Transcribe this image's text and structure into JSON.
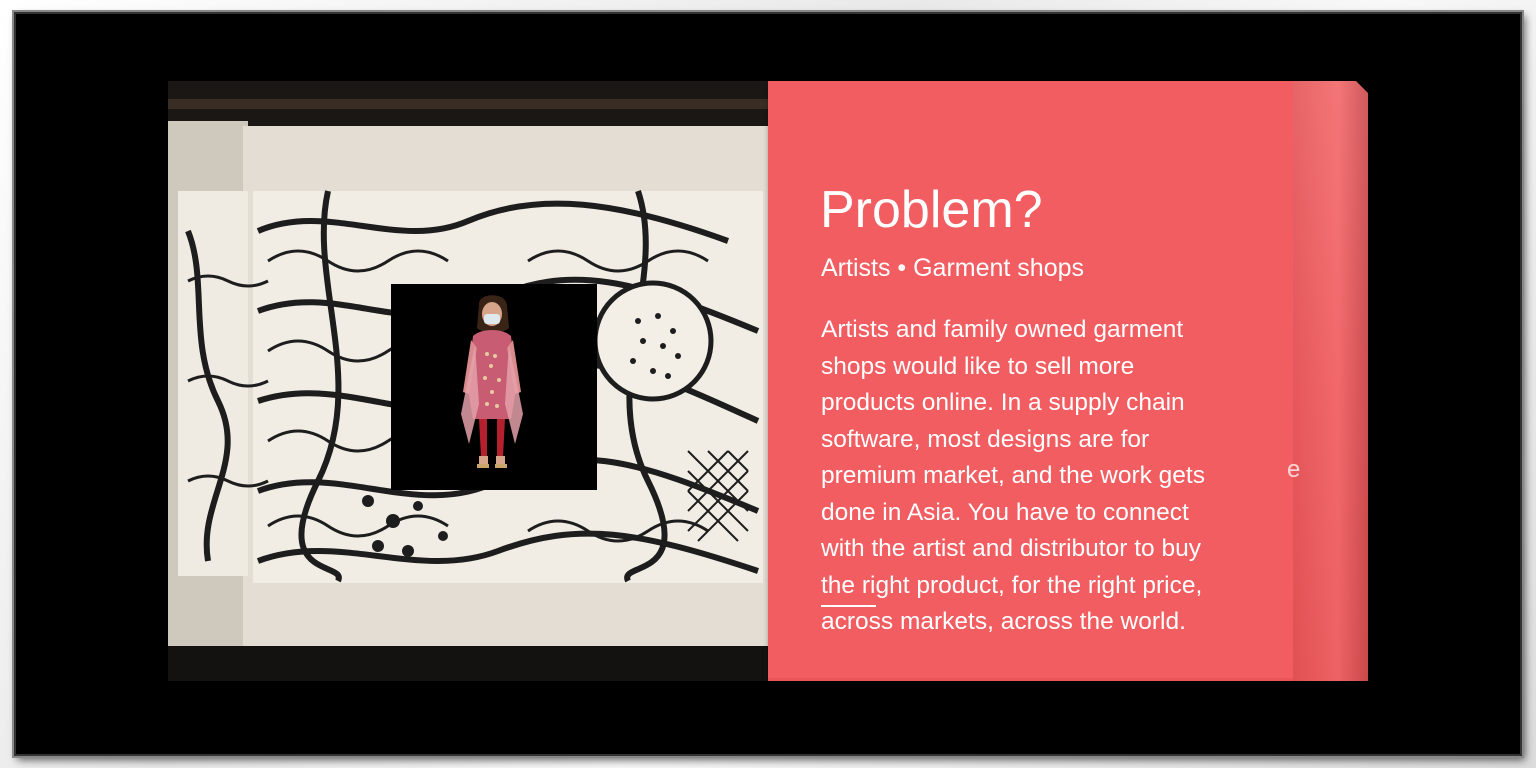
{
  "slide": {
    "title": "Problem?",
    "subtitle": "Artists • Garment shops",
    "body": "Artists and family owned garment\nshops  would like to sell more\nproducts online. In a supply chain\nsoftware, most designs are for\npremium market, and the work gets\ndone in Asia. You have to connect\nwith the artist and distributor to buy\nthe right product, for the right price,\nacross markets, across the world.",
    "ghost_char": "e"
  },
  "colors": {
    "panel": "#f15d60",
    "frame_background": "#000000",
    "text": "#ffffff"
  },
  "images": {
    "background_photo": "black-and-white-zentangle-drawing",
    "thumbnail": "woman-in-pink-outfit-with-mask"
  }
}
